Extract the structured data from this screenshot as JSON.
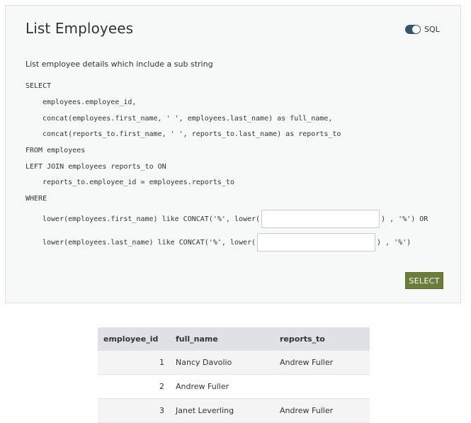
{
  "panel": {
    "title": "List Employees",
    "sql_toggle_label": "SQL",
    "sql_toggle_on": true,
    "description": "List employee details which include a sub string"
  },
  "query": {
    "select": "SELECT",
    "col1": "employees.employee_id,",
    "col2": "concat(employees.first_name, ' ', employees.last_name) as full_name,",
    "col3": "concat(reports_to.first_name, ' ', reports_to.last_name) as reports_to",
    "from": "FROM employees",
    "join": "LEFT JOIN employees reports_to ON",
    "on": "reports_to.employee_id = employees.reports_to",
    "where": "WHERE",
    "cond1_prefix": "lower(employees.first_name) like CONCAT('%', lower(",
    "cond1_suffix": ") , '%') OR",
    "cond1_value": "",
    "cond2_prefix": "lower(employees.last_name) like CONCAT('%', lower(",
    "cond2_suffix": ") , '%')",
    "cond2_value": ""
  },
  "actions": {
    "select_label": "SELECT"
  },
  "results": {
    "columns": [
      "employee_id",
      "full_name",
      "reports_to"
    ],
    "rows": [
      [
        "1",
        "Nancy Davolio",
        "Andrew Fuller"
      ],
      [
        "2",
        "Andrew Fuller",
        ""
      ],
      [
        "3",
        "Janet Leverling",
        "Andrew Fuller"
      ]
    ]
  },
  "colors": {
    "toggle": "#2f5869",
    "select_button": "#6b7d3b",
    "header_bg": "#dfe1e5"
  }
}
